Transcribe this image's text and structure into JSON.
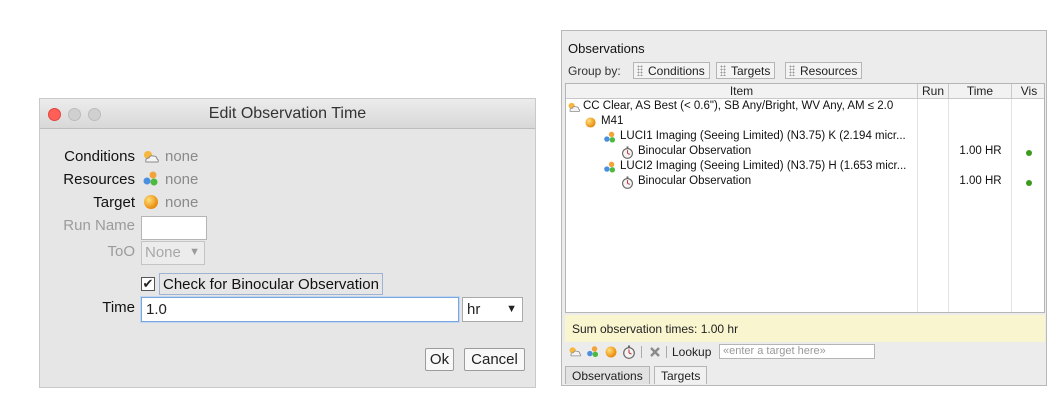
{
  "dialog": {
    "title": "Edit Observation Time",
    "labels": {
      "conditions": "Conditions",
      "resources": "Resources",
      "target": "Target",
      "run_name": "Run Name",
      "too": "ToO",
      "time": "Time"
    },
    "values": {
      "conditions": "none",
      "resources": "none",
      "target": "none"
    },
    "run_name_value": "",
    "too_selected": "None",
    "checkbox": {
      "label": "Check for Binocular Observation",
      "checked": true,
      "mark": "✔"
    },
    "time_value": "1.0",
    "time_unit": "hr",
    "buttons": {
      "ok": "Ok",
      "cancel": "Cancel"
    },
    "icons": [
      "cloud-sun-icon",
      "molecule-icon",
      "orange-sphere-icon"
    ]
  },
  "observations": {
    "title": "Observations",
    "group_by_label": "Group by:",
    "group_buttons": [
      "Conditions",
      "Targets",
      "Resources"
    ],
    "columns": {
      "item": "Item",
      "run": "Run",
      "time": "Time",
      "vis": "Vis"
    },
    "rows": [
      {
        "text": "CC Clear, AS Best (< 0.6\"), SB Any/Bright, WV Any, AM ≤ 2.0",
        "icon": "cloud-sun-icon",
        "time": "",
        "vis": false
      },
      {
        "text": "M41",
        "icon": "orange-sphere-icon",
        "time": "",
        "vis": false
      },
      {
        "text": "LUCI1 Imaging (Seeing Limited) (N3.75) K (2.194 micr...",
        "icon": "molecule-icon",
        "time": "",
        "vis": false
      },
      {
        "text": "Binocular Observation",
        "icon": "stopwatch-icon",
        "time": "1.00 HR",
        "vis": true
      },
      {
        "text": "LUCI2 Imaging (Seeing Limited) (N3.75) H (1.653 micr...",
        "icon": "molecule-icon",
        "time": "",
        "vis": false
      },
      {
        "text": "Binocular Observation",
        "icon": "stopwatch-icon",
        "time": "1.00 HR",
        "vis": true
      }
    ],
    "sum_text": "Sum observation times: 1.00 hr",
    "lookup_label": "Lookup",
    "lookup_placeholder": "«enter a target here»",
    "tabs": [
      "Observations",
      "Targets"
    ],
    "colors": {
      "vis_dot": "#3c9a1e",
      "sum_bg": "#f8f5cf"
    }
  }
}
